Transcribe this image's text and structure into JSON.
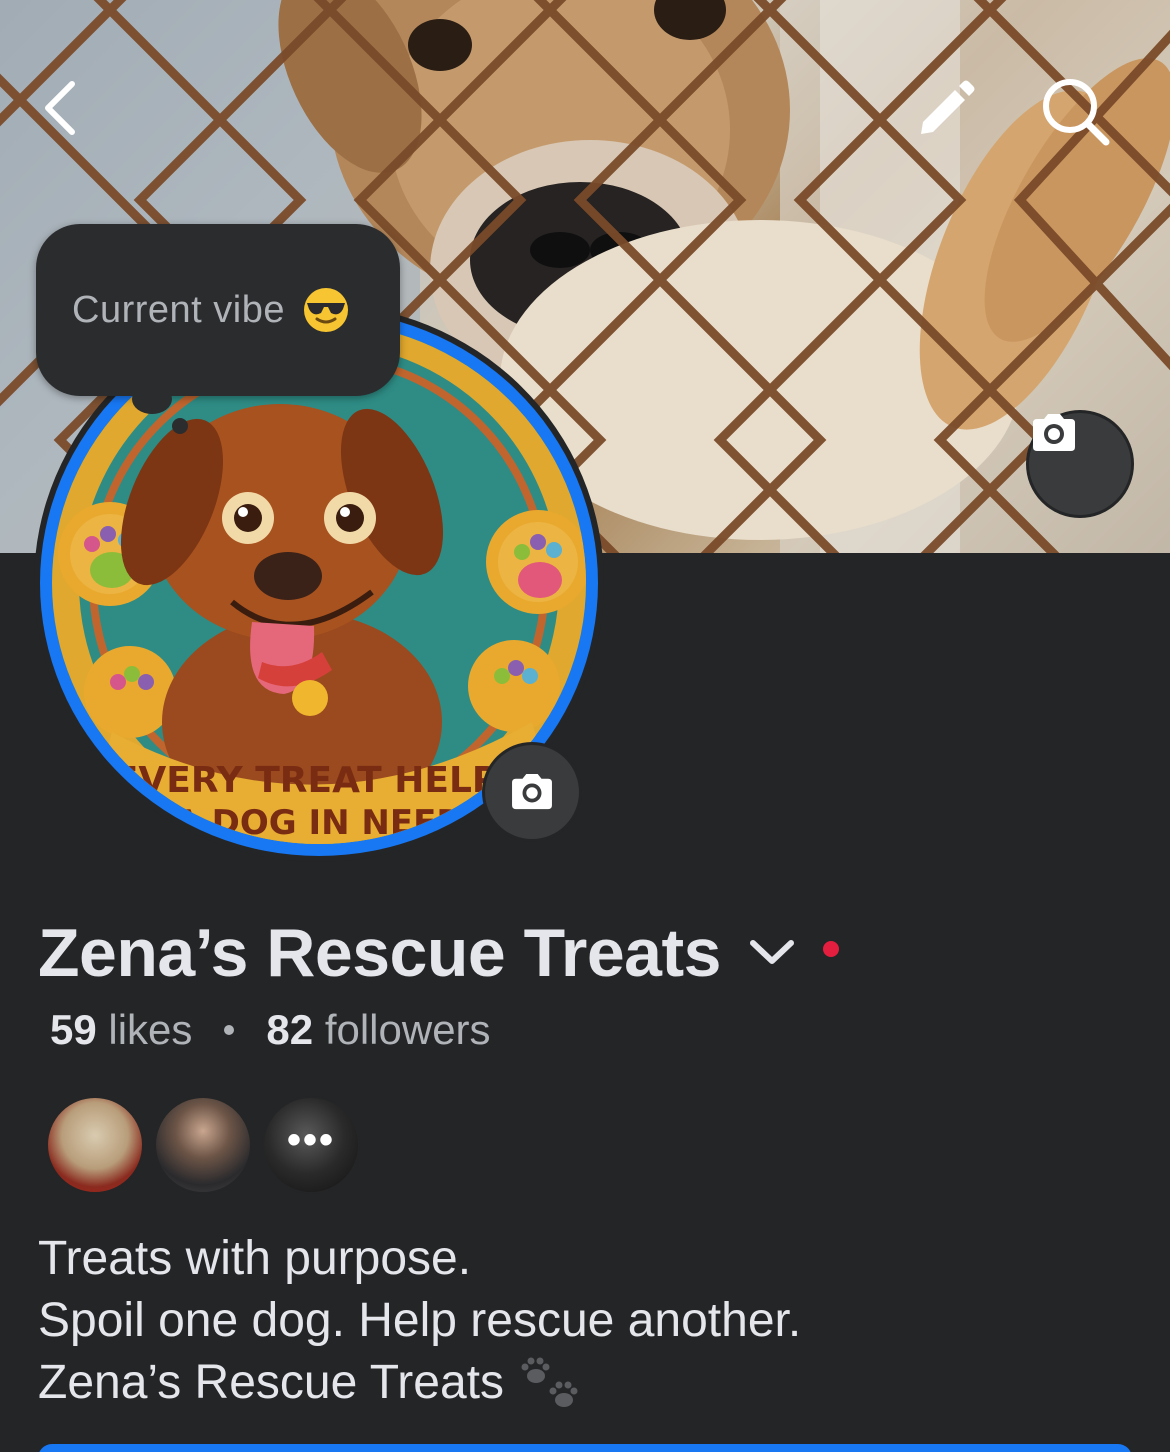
{
  "header": {
    "back_icon": "chevron-left-icon",
    "edit_icon": "pencil-icon",
    "search_icon": "search-icon"
  },
  "cover": {
    "camera_icon": "camera-icon"
  },
  "note": {
    "text": "Current vibe",
    "emoji": "sunglasses-emoji"
  },
  "profile_picture": {
    "camera_icon": "camera-icon",
    "badge_text_line1": "EVERY TREAT HELPS",
    "badge_text_line2": "A DOG IN NEED"
  },
  "page": {
    "name": "Zena’s Rescue Treats",
    "likes_count": "59",
    "likes_label": "likes",
    "followers_count": "82",
    "followers_label": "followers"
  },
  "friends": {
    "more_label": "•••"
  },
  "bio": {
    "line1": "Treats with purpose.",
    "line2": "Spoil one dog. Help rescue another.",
    "line3": "Zena’s Rescue Treats"
  },
  "colors": {
    "background": "#242526",
    "accent": "#1877f2",
    "notification_dot": "#e41e3f"
  }
}
